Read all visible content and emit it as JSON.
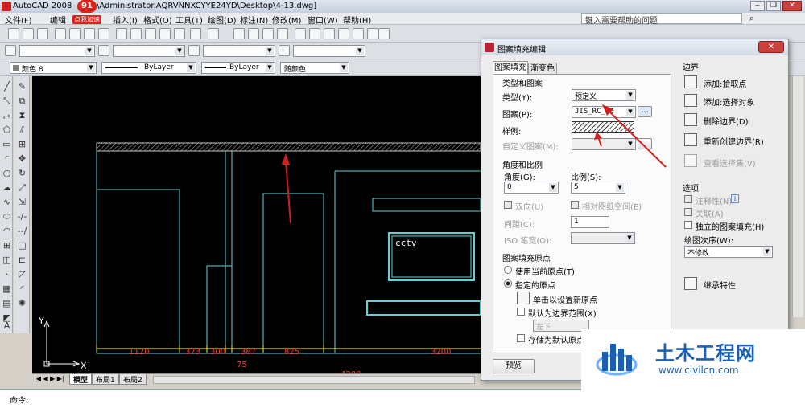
{
  "window": {
    "title": "AutoCAD 2008 - [C:\\Documents and Settings\\Administrator.AQRVNNXCYYE24YD\\Desktop\\4-13.dwg]",
    "title_visible": "AutoCAD 2008",
    "title_tail": "\\Administrator.AQRVNNXCYYE24YD\\Desktop\\4-13.dwg]"
  },
  "badge": {
    "count": "91",
    "label": "点我加速"
  },
  "menu": [
    "文件(F)",
    "编辑",
    "插入(I)",
    "格式(O)",
    "工具(T)",
    "绘图(D)",
    "标注(N)",
    "修改(M)",
    "窗口(W)",
    "帮助(H)"
  ],
  "help_search": {
    "placeholder": "键入需要帮助的问题"
  },
  "layer_toolbar": {
    "color": "颜色 8",
    "linetype": "ByLayer",
    "lineweight": "ByLayer",
    "plotstyle": "随颜色"
  },
  "drawing": {
    "label_cctv": "cctv",
    "dims": [
      "1120",
      "373",
      "300",
      "387",
      "825",
      "3200"
    ],
    "dim_below": "75",
    "dim_partial": "4200",
    "axis_x": "X",
    "axis_y": "Y"
  },
  "layout_tabs": [
    "模型",
    "布局1",
    "布局2"
  ],
  "command": {
    "prompt": "命令:"
  },
  "dialog": {
    "title": "图案填充编辑",
    "tabs": [
      "图案填充",
      "渐变色"
    ],
    "type_pattern": {
      "group": "类型和图案",
      "type_label": "类型(Y):",
      "type_value": "预定义",
      "pattern_label": "图案(P):",
      "pattern_value": "JIS_RC_10",
      "sample_label": "样例:",
      "custom_label": "自定义图案(M):",
      "browse": "..."
    },
    "angle_scale": {
      "group": "角度和比例",
      "angle_label": "角度(G):",
      "angle_value": "0",
      "scale_label": "比例(S):",
      "scale_value": "5",
      "double_label": "双向(U)",
      "relative_label": "相对图纸空间(E)",
      "spacing_label": "间距(C):",
      "spacing_value": "1",
      "iso_label": "ISO 笔宽(O):"
    },
    "origin": {
      "group": "图案填充原点",
      "use_current": "使用当前原点(T)",
      "specified": "指定的原点",
      "click_set": "单击以设置新原点",
      "default_extent": "默认为边界范围(X)",
      "extent_value": "左下",
      "store_default": "存储为默认原点(F)"
    },
    "boundary": {
      "group": "边界",
      "add_pick": "添加:拾取点",
      "add_select": "添加:选择对象",
      "remove": "删除边界(D)",
      "recreate": "重新创建边界(R)",
      "view_select": "查看选择集(V)"
    },
    "options": {
      "group": "选项",
      "annotative": "注释性(N)",
      "associative": "关联(A)",
      "separate": "独立的图案填充(H)",
      "draw_order_label": "绘图次序(W):",
      "draw_order_value": "不修改"
    },
    "inherit": "继承特性",
    "preview": "预览"
  },
  "watermark": {
    "brand": "土木工程网",
    "url": "www.civilcn.com"
  },
  "colors": {
    "canvas_bg": "#000000",
    "cyan": "#5fd3d3",
    "dim_red": "#ff3b30",
    "dim_yellow": "#ffff00",
    "arrow_red": "#d21f1f",
    "brand_blue": "#1a5fb4"
  }
}
